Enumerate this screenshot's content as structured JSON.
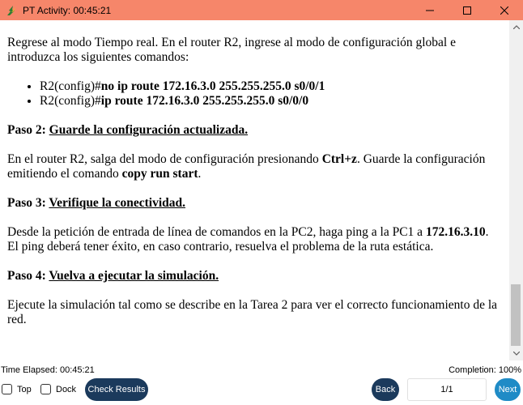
{
  "window": {
    "title": "PT Activity: 00:45:21",
    "icon": "packet-tracer-icon",
    "controls": [
      "minimize-icon",
      "maximize-icon",
      "close-icon"
    ]
  },
  "content": {
    "intro": "Regrese al modo Tiempo real. En el router R2, ingrese al modo de configuración global e introduzca los siguientes comandos:",
    "commands": [
      {
        "prompt": "R2(config)#",
        "command": "no ip route 172.16.3.0 255.255.255.0 s0/0/1"
      },
      {
        "prompt": "R2(config)#",
        "command": "ip route 172.16.3.0 255.255.255.0 s0/0/0"
      }
    ],
    "step2": {
      "label": "Paso 2: ",
      "title": "Guarde la configuración actualizada.",
      "text_a": "En el router R2, salga del modo de configuración presionando ",
      "key": "Ctrl+z",
      "text_b": ". Guarde la configuración emitiendo el comando ",
      "cmd": "copy run start",
      "text_c": "."
    },
    "step3": {
      "label": "Paso 3: ",
      "title": "Verifique la conectividad.",
      "text_a": "Desde la petición de entrada de línea de comandos en la PC2, haga ping a la PC1 a ",
      "ip": "172.16.3.10",
      "text_b": ". El ping deberá tener éxito, en caso contrario, resuelva el problema de la ruta estática."
    },
    "step4": {
      "label": "Paso 4: ",
      "title": "Vuelva a ejecutar la simulación.",
      "text": "Ejecute la simulación tal como se describe en la Tarea 2 para ver el correcto funcionamiento de la red."
    }
  },
  "status": {
    "elapsed": "Time Elapsed: 00:45:21",
    "completion": "Completion: 100%"
  },
  "controls": {
    "top_label": "Top",
    "dock_label": "Dock",
    "check_results": "Check Results",
    "back": "Back",
    "page": "1/1",
    "next": "Next"
  },
  "colors": {
    "titlebar": "#f6866a",
    "button": "#1b3a5c",
    "next_button": "#1f8bc6"
  }
}
